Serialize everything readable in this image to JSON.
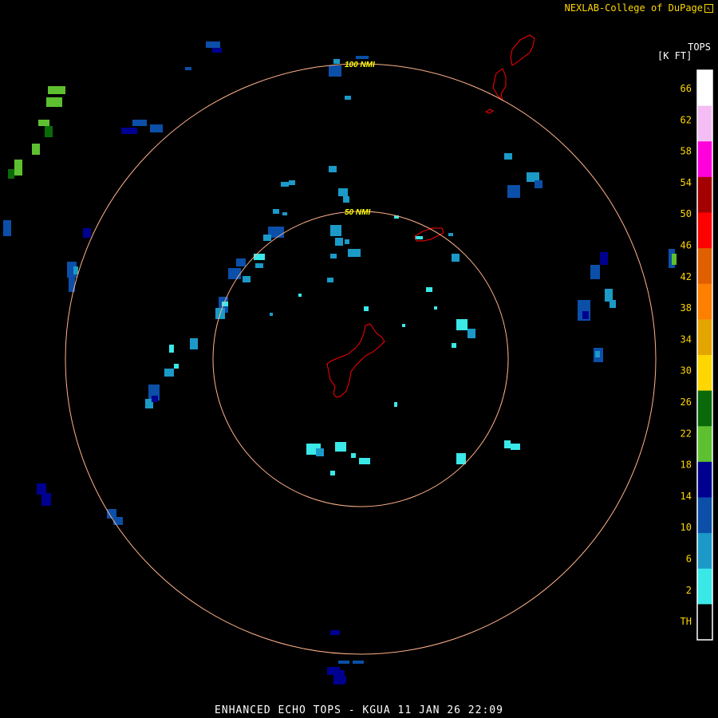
{
  "credit": {
    "text": "NEXLAB-College of DuPage",
    "mark_icon": "corner-arrow-icon"
  },
  "scale": {
    "title_line1": "TOPS",
    "title_line2": "[K FT]",
    "labels": [
      "66",
      "62",
      "58",
      "54",
      "50",
      "46",
      "42",
      "38",
      "34",
      "30",
      "26",
      "22",
      "18",
      "14",
      "10",
      "6",
      "2",
      "TH"
    ],
    "colors": [
      "#ffffff",
      "#f4bdf4",
      "#ff00dd",
      "#a50000",
      "#ff0000",
      "#e06000",
      "#ff7f00",
      "#e5a500",
      "#ffd700",
      "#0a6a0a",
      "#5ec030",
      "#000090",
      "#0b4fa8",
      "#1b9ac8",
      "#3ae8e8",
      "#000000"
    ]
  },
  "rings": [
    {
      "range_nmi": 50,
      "label": "50 NMI"
    },
    {
      "range_nmi": 100,
      "label": "100 NMI"
    }
  ],
  "footer": "ENHANCED ECHO TOPS - KGUA 11 JAN 26 22:09",
  "colors": {
    "ring": "#ffb38a",
    "coast": "#ff0000",
    "ring_label": "#ffff00",
    "text": "#ffd700"
  }
}
